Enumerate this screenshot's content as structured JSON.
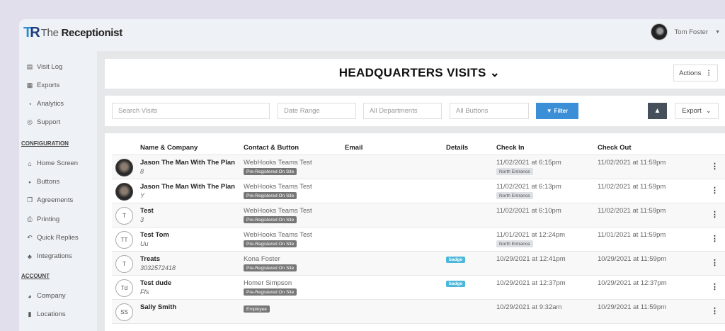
{
  "app": {
    "logo_mark": "TR",
    "logo_the": "The",
    "logo_name": "Receptionist",
    "user_name": "Tom Foster"
  },
  "sidebar": {
    "main_items": [
      {
        "label": "Visit Log",
        "icon": "file-icon"
      },
      {
        "label": "Exports",
        "icon": "calendar-icon"
      },
      {
        "label": "Analytics",
        "icon": "dashboard-icon"
      },
      {
        "label": "Support",
        "icon": "lifebuoy-icon"
      }
    ],
    "config_heading": "CONFIGURATION",
    "config_items": [
      {
        "label": "Home Screen",
        "icon": "home-icon"
      },
      {
        "label": "Buttons",
        "icon": "grid-icon"
      },
      {
        "label": "Agreements",
        "icon": "copy-icon"
      },
      {
        "label": "Printing",
        "icon": "printer-icon"
      },
      {
        "label": "Quick Replies",
        "icon": "reply-icon"
      },
      {
        "label": "Integrations",
        "icon": "sitemap-icon"
      }
    ],
    "account_heading": "ACCOUNT",
    "account_items": [
      {
        "label": "Company",
        "icon": "globe-icon"
      },
      {
        "label": "Locations",
        "icon": "building-icon"
      }
    ]
  },
  "header": {
    "title": "HEADQUARTERS VISITS",
    "actions_label": "Actions"
  },
  "toolbar": {
    "search_placeholder": "Search Visits",
    "date_placeholder": "Date Range",
    "departments": "All Departments",
    "buttons": "All Buttons",
    "filter_label": "Filter",
    "export_label": "Export"
  },
  "table": {
    "columns": [
      "Name & Company",
      "Contact & Button",
      "Email",
      "Details",
      "Check In",
      "Check Out"
    ],
    "rows": [
      {
        "avatar": "",
        "photo": true,
        "name": "Jason The Man With The Plan",
        "company": "8",
        "contact": "WebHooks Teams Test",
        "button": "Pre-Registered On Site",
        "details": "",
        "check_in": "11/02/2021 at 6:15pm",
        "entrance": "North Entrance",
        "check_out": "11/02/2021 at 11:59pm"
      },
      {
        "avatar": "",
        "photo": true,
        "name": "Jason The Man With The Plan",
        "company": "Y",
        "contact": "WebHooks Teams Test",
        "button": "Pre-Registered On Site",
        "details": "",
        "check_in": "11/02/2021 at 6:13pm",
        "entrance": "North Entrance",
        "check_out": "11/02/2021 at 11:59pm"
      },
      {
        "avatar": "T",
        "photo": false,
        "name": "Test",
        "company": "3",
        "contact": "WebHooks Teams Test",
        "button": "Pre-Registered On Site",
        "details": "",
        "check_in": "11/02/2021 at 6:10pm",
        "entrance": "",
        "check_out": "11/02/2021 at 11:59pm"
      },
      {
        "avatar": "TT",
        "photo": false,
        "name": "Test Tom",
        "company": "Uu",
        "contact": "WebHooks Teams Test",
        "button": "Pre-Registered On Site",
        "details": "",
        "check_in": "11/01/2021 at 12:24pm",
        "entrance": "North Entrance",
        "check_out": "11/01/2021 at 11:59pm"
      },
      {
        "avatar": "T",
        "photo": false,
        "name": "Treats",
        "company": "3032572418",
        "contact": "Kona Foster",
        "button": "Pre-Registered On Site",
        "details": "badge",
        "check_in": "10/29/2021 at 12:41pm",
        "entrance": "",
        "check_out": "10/29/2021 at 11:59pm"
      },
      {
        "avatar": "Td",
        "photo": false,
        "name": "Test dude",
        "company": "Ffs",
        "contact": "Homer Simpson",
        "button": "Pre-Registered On Site",
        "details": "badge",
        "check_in": "10/29/2021 at 12:37pm",
        "entrance": "",
        "check_out": "10/29/2021 at 12:37pm"
      },
      {
        "avatar": "SS",
        "photo": false,
        "name": "Sally Smith",
        "company": "",
        "contact": "",
        "button": "Employee",
        "details": "",
        "check_in": "10/29/2021 at 9:32am",
        "entrance": "",
        "check_out": "10/29/2021 at 11:59pm"
      }
    ]
  },
  "colors": {
    "accent": "#3a8fd6",
    "badge": "#4bb8d9",
    "background": "#e1dfeb"
  }
}
